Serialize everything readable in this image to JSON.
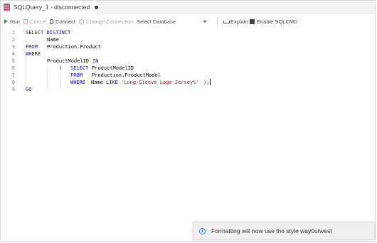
{
  "tab": {
    "title": "SQLQuery_1 - disconnected",
    "modified_indicator": "unsaved-dot"
  },
  "toolbar": {
    "run_label": "Run",
    "cancel_label": "Cancel",
    "connect_label": "Connect",
    "change_connection_label": "Change Connection",
    "database_select": "Select Database",
    "explain_label": "Explain",
    "sqlcmd_label": "Enable SQLCMD"
  },
  "editor": {
    "line_numbers": [
      "1",
      "2",
      "3",
      "4",
      "5",
      "6",
      "7",
      "8",
      "9"
    ],
    "lines": {
      "l1": {
        "kw1": "SELECT DISTINCT"
      },
      "l2": {
        "t1": "Name"
      },
      "l3": {
        "kw1": "FROM",
        "t1": "Production.Product"
      },
      "l4": {
        "kw1": "WHERE"
      },
      "l5": {
        "t1": "ProductModelID",
        "kw1": "IN"
      },
      "l6": {
        "t1": "(",
        "kw1": "SELECT",
        "t2": "ProductModelID"
      },
      "l7": {
        "kw1": "FROM",
        "t1": "Production.ProductModel"
      },
      "l8": {
        "kw1": "WHERE",
        "t1": "Name",
        "kw2": "LIKE",
        "str1": "'Long-Sleeve Logo Jersey%'",
        "t2": ");"
      },
      "l9": {
        "kw1": "GO"
      }
    }
  },
  "notification": {
    "message": "Formatting will now use the style way0utwest",
    "icon": "info-icon"
  },
  "colors": {
    "keyword": "#0000ff",
    "string": "#a31515",
    "line_number": "#2b91af",
    "tab_icon": "#d94f6a",
    "run": "#3a9c3a"
  }
}
